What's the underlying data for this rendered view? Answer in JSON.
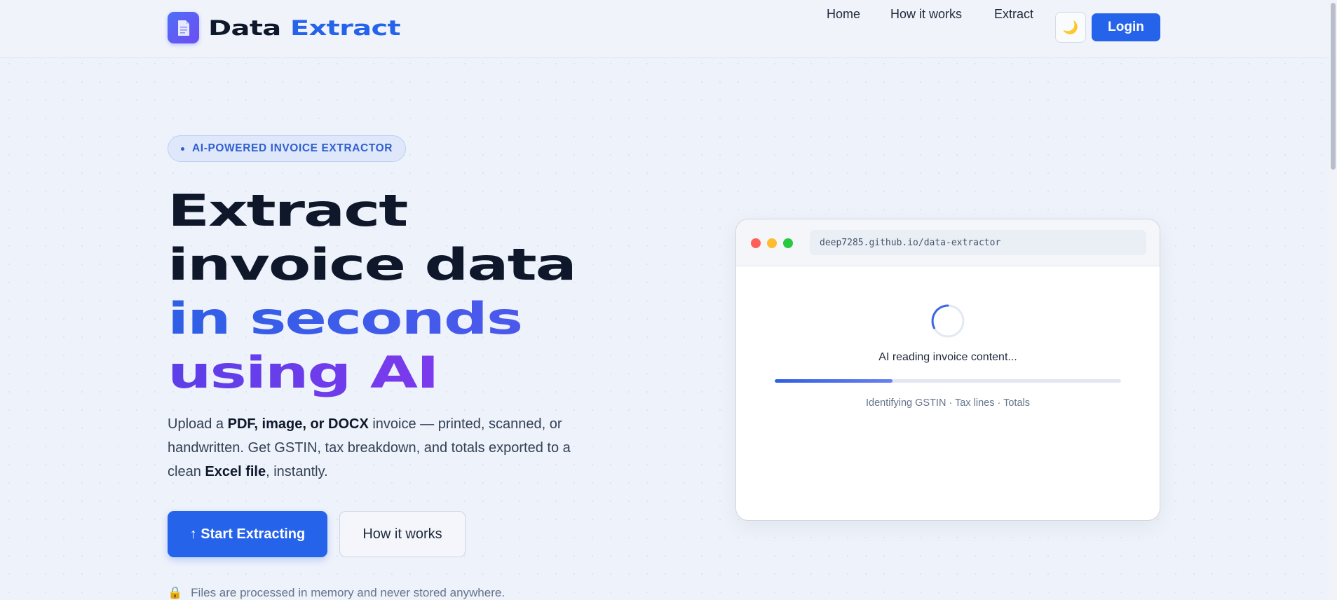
{
  "brand": {
    "name_part1": "Data",
    "name_part2": "Extract",
    "icon": "document-icon",
    "accent": "#2563eb"
  },
  "nav": {
    "links": [
      "Home",
      "How it works",
      "Extract"
    ],
    "theme_toggle_icon": "moon-icon",
    "theme_toggle_glyph": "🌙",
    "login_label": "Login"
  },
  "hero": {
    "badge": "AI-POWERED INVOICE EXTRACTOR",
    "headline": {
      "line1": "Extract",
      "line2": "invoice data",
      "line3": "in seconds",
      "line4": "using AI"
    },
    "description": {
      "p1": "Upload a ",
      "b1": "PDF, image, or DOCX",
      "p2": " invoice — printed, scanned, or handwritten. Get GSTIN, tax breakdown, and totals exported to a clean ",
      "b2": "Excel file",
      "p3": ", instantly."
    },
    "primary_button": "↑ Start Extracting",
    "secondary_button": "How it works",
    "privacy_note": "Files are processed in memory and never stored anywhere.",
    "privacy_icon": "lock-icon",
    "privacy_glyph": "🔒"
  },
  "preview": {
    "url": "deep7285.github.io/data-extractor",
    "traffic_colors": [
      "#ff5f57",
      "#febc2e",
      "#28c840"
    ],
    "status": "AI reading invoice content...",
    "progress": 0.34,
    "steps": "Identifying GSTIN · Tax lines · Totals"
  }
}
